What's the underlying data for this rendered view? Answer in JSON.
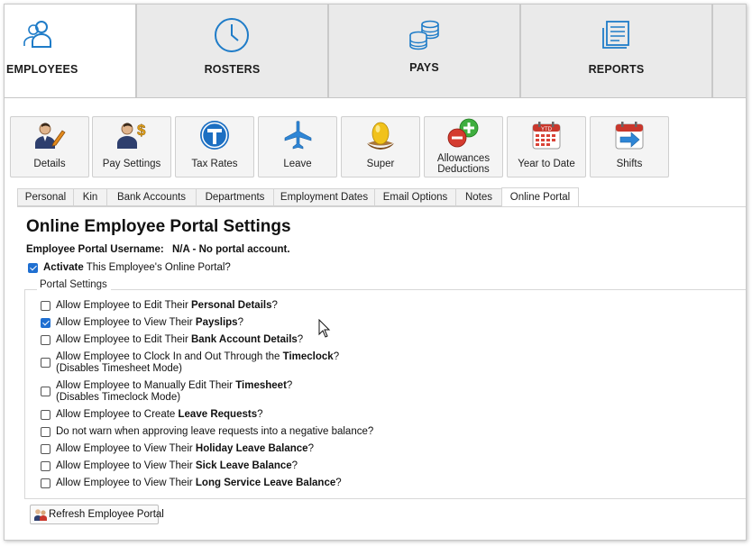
{
  "nav": {
    "tabs": [
      {
        "label": "EMPLOYEES",
        "icon": "employees-icon",
        "active": true
      },
      {
        "label": "ROSTERS",
        "icon": "clock-icon"
      },
      {
        "label": "PAYS",
        "icon": "coins-icon"
      },
      {
        "label": "REPORTS",
        "icon": "report-icon"
      }
    ]
  },
  "toolbar": {
    "buttons": [
      {
        "label": "Details",
        "icon": "person-edit-icon"
      },
      {
        "label": "Pay Settings",
        "icon": "person-dollar-icon"
      },
      {
        "label": "Tax Rates",
        "icon": "tax-t-icon"
      },
      {
        "label": "Leave",
        "icon": "airplane-icon"
      },
      {
        "label": "Super",
        "icon": "golden-egg-icon"
      },
      {
        "label": "Allowances Deductions",
        "icon": "plus-minus-icon"
      },
      {
        "label": "Year to Date",
        "icon": "calendar-ytd-icon"
      },
      {
        "label": "Shifts",
        "icon": "calendar-shift-icon"
      }
    ]
  },
  "subtabs": [
    "Personal",
    "Kin",
    "Bank Accounts",
    "Departments",
    "Employment Dates",
    "Email Options",
    "Notes",
    "Online Portal"
  ],
  "active_subtab": "Online Portal",
  "portal": {
    "title": "Online Employee Portal Settings",
    "username_label": "Employee Portal Username:",
    "username_value": "N/A - No portal account.",
    "activate_bold": "Activate",
    "activate_rest": " This Employee's Online Portal?",
    "activate_checked": true,
    "group_label": "Portal Settings",
    "options": [
      {
        "pre": "Allow Employee to Edit Their ",
        "bold": "Personal Details",
        "post": "?",
        "checked": false
      },
      {
        "pre": "Allow Employee to View Their ",
        "bold": "Payslips",
        "post": "?",
        "checked": true
      },
      {
        "pre": "Allow Employee to Edit Their ",
        "bold": "Bank Account Details",
        "post": "?",
        "checked": false
      },
      {
        "pre": "Allow Employee to Clock In and Out Through the ",
        "bold": "Timeclock",
        "post": "?",
        "sub": "(Disables Timesheet Mode)",
        "checked": false
      },
      {
        "pre": "Allow Employee to Manually Edit Their ",
        "bold": "Timesheet",
        "post": "?",
        "sub": "(Disables Timeclock Mode)",
        "checked": false
      },
      {
        "pre": "Allow Employee to Create ",
        "bold": "Leave Requests",
        "post": "?",
        "checked": false
      },
      {
        "pre": "Do not warn when approving leave requests into a negative balance?",
        "bold": "",
        "post": "",
        "checked": false
      },
      {
        "pre": "Allow Employee to View Their ",
        "bold": "Holiday Leave Balance",
        "post": "?",
        "checked": false
      },
      {
        "pre": "Allow Employee to View Their ",
        "bold": "Sick Leave Balance",
        "post": "?",
        "checked": false
      },
      {
        "pre": "Allow Employee to View Their ",
        "bold": "Long Service Leave Balance",
        "post": "?",
        "checked": false
      }
    ],
    "refresh_label": "Refresh Employee Portal"
  },
  "colors": {
    "accent": "#1f7cc8",
    "check": "#1f6fd1"
  }
}
